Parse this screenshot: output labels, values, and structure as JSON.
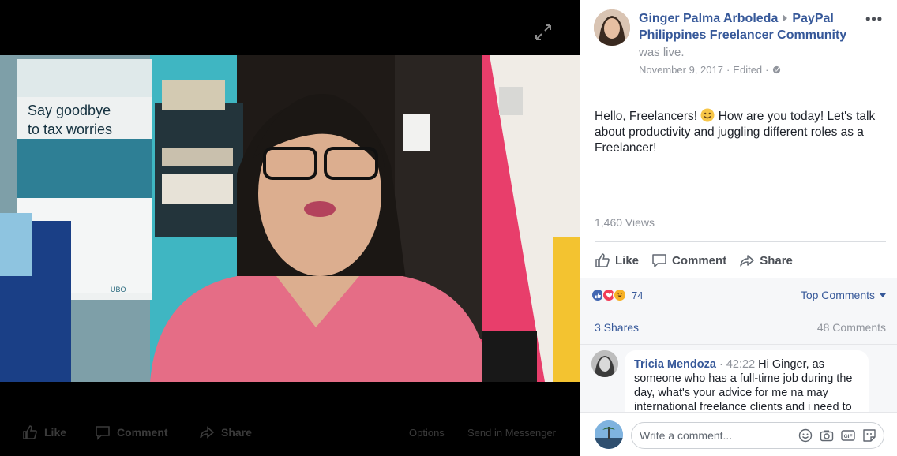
{
  "video": {
    "banner_line1": "Say goodbye",
    "banner_line2": "to tax worries",
    "banner_logo": "UBO",
    "actions": {
      "like": "Like",
      "comment": "Comment",
      "share": "Share",
      "options": "Options",
      "send": "Send in Messenger"
    },
    "icons": {
      "expand": "expand-icon"
    }
  },
  "post": {
    "author": "Ginger Palma Arboleda",
    "group": "PayPal Philippines Freelancer Community",
    "status": "was live.",
    "date": "November 9, 2017",
    "edited": "Edited",
    "separator": "·",
    "more": "•••",
    "text_before_emoji": "Hello, Freelancers! ",
    "text_after_emoji": " How are you today! Let's talk about productivity and juggling different roles as a Freelancer!",
    "views": "1,460 Views",
    "actions": {
      "like": "Like",
      "comment": "Comment",
      "share": "Share"
    }
  },
  "engagement": {
    "reaction_count": "74",
    "reaction_types": [
      "like",
      "love",
      "haha"
    ],
    "sort_label": "Top Comments",
    "shares": "3 Shares",
    "comments": "48 Comments"
  },
  "comments": [
    {
      "author": "Tricia Mendoza",
      "time": "42:22",
      "text": " Hi Ginger, as someone who has a full-time job during the day, what's your advice for me na may international freelance clients and i need to"
    }
  ],
  "composer": {
    "placeholder": "Write a comment...",
    "icons": [
      "emoji-icon",
      "camera-icon",
      "gif-icon",
      "sticker-icon"
    ]
  },
  "colors": {
    "link": "#365899",
    "muted": "#90949c",
    "like_blue": "#4267b2",
    "love_red": "#f33e58",
    "haha_yellow": "#f7b125"
  }
}
